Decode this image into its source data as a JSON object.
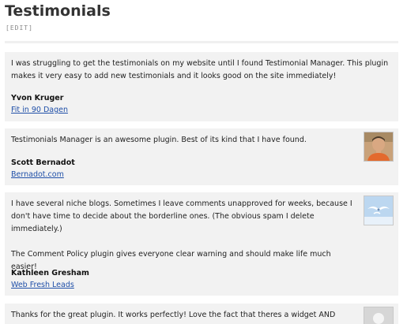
{
  "page": {
    "title": "Testimonials",
    "edit_label": "[EDIT]"
  },
  "testimonials": [
    {
      "text": "I was struggling to get the testimonials on my website until I found Testimonial Manager. This plugin makes it very easy to add new testimonials and it looks good on the site immediately!",
      "author": "Yvon Kruger",
      "link": "Fit in 90 Dagen",
      "avatar": "none"
    },
    {
      "text": "Testimonials Manager is an awesome plugin. Best of its kind that I have found.",
      "author": "Scott Bernadot",
      "link": "Bernadot.com",
      "avatar": "man-photo-avatar"
    },
    {
      "text": "I have several niche blogs. Sometimes I leave comments unapproved for weeks, because I don't have time to decide about the borderline ones. (The obvious spam I delete immediately.)\n\nThe Comment Policy plugin gives everyone clear warning and should make life much easier!",
      "author": "Kathleen Gresham",
      "link": "Web Fresh Leads",
      "avatar": "bird-sky-avatar"
    },
    {
      "text": "Thanks for the great plugin. It works perfectly! Love the fact that theres a widget AND",
      "avatar": "default-gray-avatar"
    }
  ]
}
